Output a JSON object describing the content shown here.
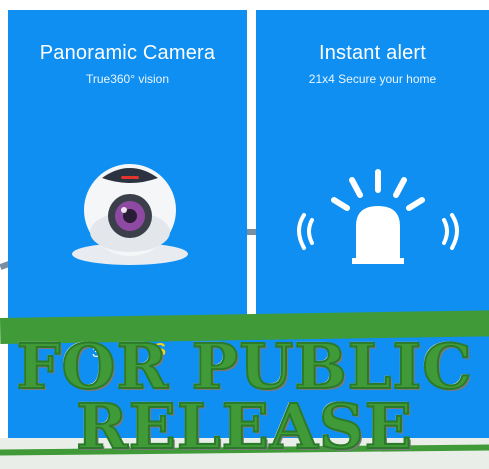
{
  "left_panel": {
    "title": "Panoramic Camera",
    "subtitle": "True360° vision"
  },
  "right_panel": {
    "title": "Instant alert",
    "subtitle": "21x4 Secure your home"
  },
  "lower": {
    "partial_text": "3",
    "partial_text_2": "S"
  },
  "watermark": {
    "line1": "FOR PUBLIC",
    "line2": "RELEASE"
  },
  "colors": {
    "panel_blue": "#0f8ff2",
    "stamp_green": "#3f9a37"
  }
}
